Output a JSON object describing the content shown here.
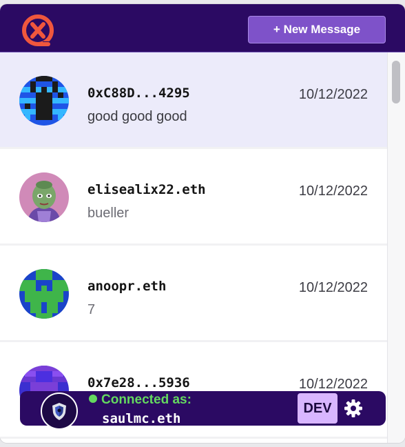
{
  "header": {
    "new_message_label": "+ New Message"
  },
  "conversations": [
    {
      "name": "0xC88D...4295",
      "preview": "good good good",
      "date": "10/12/2022",
      "avatar": "pixel-avatar-blue-black",
      "active": true
    },
    {
      "name": "elisealix22.eth",
      "preview": "bueller",
      "date": "10/12/2022",
      "avatar": "pepe-avatar",
      "active": false
    },
    {
      "name": "anoopr.eth",
      "preview": "7",
      "date": "10/12/2022",
      "avatar": "pixel-avatar-green-blue",
      "active": false
    },
    {
      "name": "0x7e28...5936",
      "preview": "",
      "date": "10/12/2022",
      "avatar": "pixel-avatar-purple",
      "active": false
    }
  ],
  "footer": {
    "status": "Connected as:",
    "username": "saulmc.eth",
    "env_badge": "DEV"
  },
  "icons": {
    "logo": "xmtp-logo",
    "settings": "gear-icon"
  },
  "colors": {
    "header_bg": "#2b0a63",
    "accent": "#7e52c9",
    "connected": "#64d95f",
    "active_row": "#ecebfa",
    "dev_badge": "#d8b6ff"
  }
}
